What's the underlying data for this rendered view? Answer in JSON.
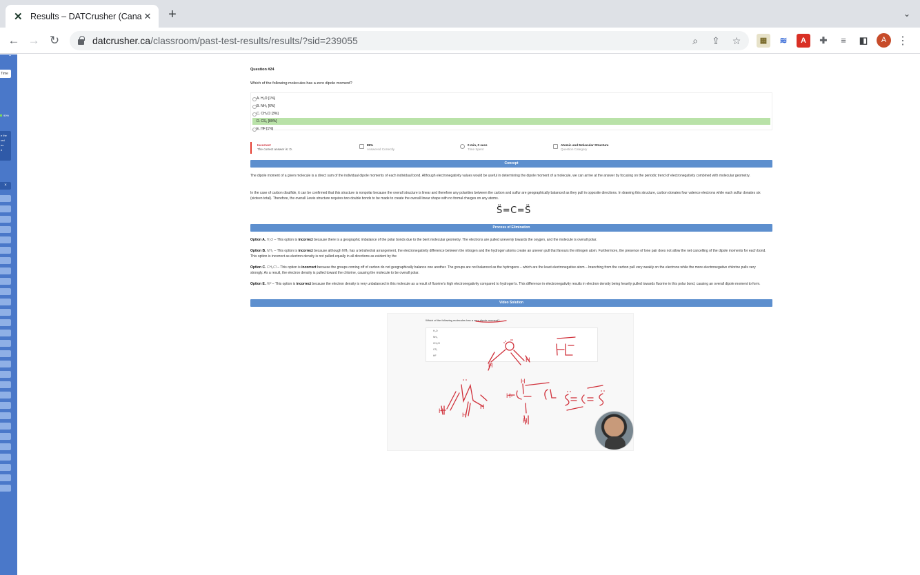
{
  "browser": {
    "tab_title": "Results – DATCrusher (Canadia",
    "url_host": "datcrusher.ca",
    "url_path": "/classroom/past-test-results/results/?sid=239055",
    "avatar_initial": "A"
  },
  "sidebar": {
    "time_label": "Time",
    "percent": "90%",
    "box_text": "e the\nred\nes\nd",
    "close_label": "×"
  },
  "question": {
    "number_label": "Question #24",
    "text": "Which of the following molecules has a zero dipole moment?",
    "choices": [
      {
        "label": "A. H₂O [1%]",
        "correct": false
      },
      {
        "label": "B. NH₃ [6%]",
        "correct": false
      },
      {
        "label": "C. CH₃Cl [3%]",
        "correct": false
      },
      {
        "label": "D. CS₂ [89%]",
        "correct": true
      },
      {
        "label": "E. HF [1%]",
        "correct": false
      }
    ]
  },
  "result": {
    "status": "Incorrect",
    "status_sub": "The correct answer is: D.",
    "answered_value": "89%",
    "answered_label": "Answered Correctly",
    "time_value": "0 min, 0 secs",
    "time_label": "Time Spent",
    "category_value": "Atomic and Molecular Structure",
    "category_label": "Question Category"
  },
  "sections": {
    "concept": "Concept",
    "elimination": "Process of Elimination",
    "video": "Video Solution"
  },
  "concept_text": {
    "p1": "The dipole moment of a given molecule is a direct sum of the individual dipole moments of each individual bond. Although electronegativity values would be useful in determining the dipole moment of a molecule, we can arrive at the answer by focusing on the periodic trend of electronegativity combined with molecular geometry.",
    "p2": "In the case of carbon disulfide, it can be confirmed that this structure is nonpolar because the overall structure is linear and therefore any polarities between the carbon and sulfur are geographically balanced as they pull in opposite directions. In drawing this structure, carbon donates four valence electrons while each sulfur donates six (sixteen total). Therefore, the overall Lewis structure requires two double bonds to be made to create the overall linear shape with no formal charges on any atoms.",
    "lewis": "S̈=C=S̈"
  },
  "elimination": [
    {
      "head": "Option A.",
      "formula": "H₂O",
      "text": " – This option is ",
      "bold": "incorrect",
      "rest": " because there is a geographic imbalance of the polar bonds due to the bent molecular geometry. The electrons are pulled unevenly towards the oxygen, and the molecule is overall polar."
    },
    {
      "head": "Option B.",
      "formula": "NH₃",
      "text": " – This option is ",
      "bold": "incorrect",
      "rest": " because although NH₃ has a tetrahedral arrangement, the electronegativity difference between the nitrogen and the hydrogen atoms create an uneven pull that favours the nitrogen atom. Furthermore, the presence of lone pair does not allow the net cancelling of the dipole moments for each bond. This option is incorrect as electron density is not pulled equally in all directions as evident by the"
    },
    {
      "head": "Option C.",
      "formula": "CH₃Cl",
      "text": " – This option is ",
      "bold": "incorrect",
      "rest": " because the groups coming off of carbon do not geographically balance one another. The groups are not balanced as the hydrogens – which are the least electronegative atom – branching from the carbon pull very weakly on the electrons while the more electronegative chlorine pulls very strongly. As a result, the electron density is pulled toward the chlorine, causing the molecule to be overall polar."
    },
    {
      "head": "Option E.",
      "formula": "HF",
      "text": " – This option is ",
      "bold": "incorrect",
      "rest": " because the electron density is very unbalanced in this molecule as a result of fluorine's high electronegativity compared to hydrogen's. This difference in electronegativity results in electron density being heavily pulled towards fluorine in this polar bond, causing an overall dipole moment to form."
    }
  ],
  "video": {
    "question": "Which of the following molecules has a zero dipole moment?",
    "options": [
      "H₂O",
      "NH₃",
      "CH₃Cl",
      "CS₂",
      "HF"
    ]
  }
}
